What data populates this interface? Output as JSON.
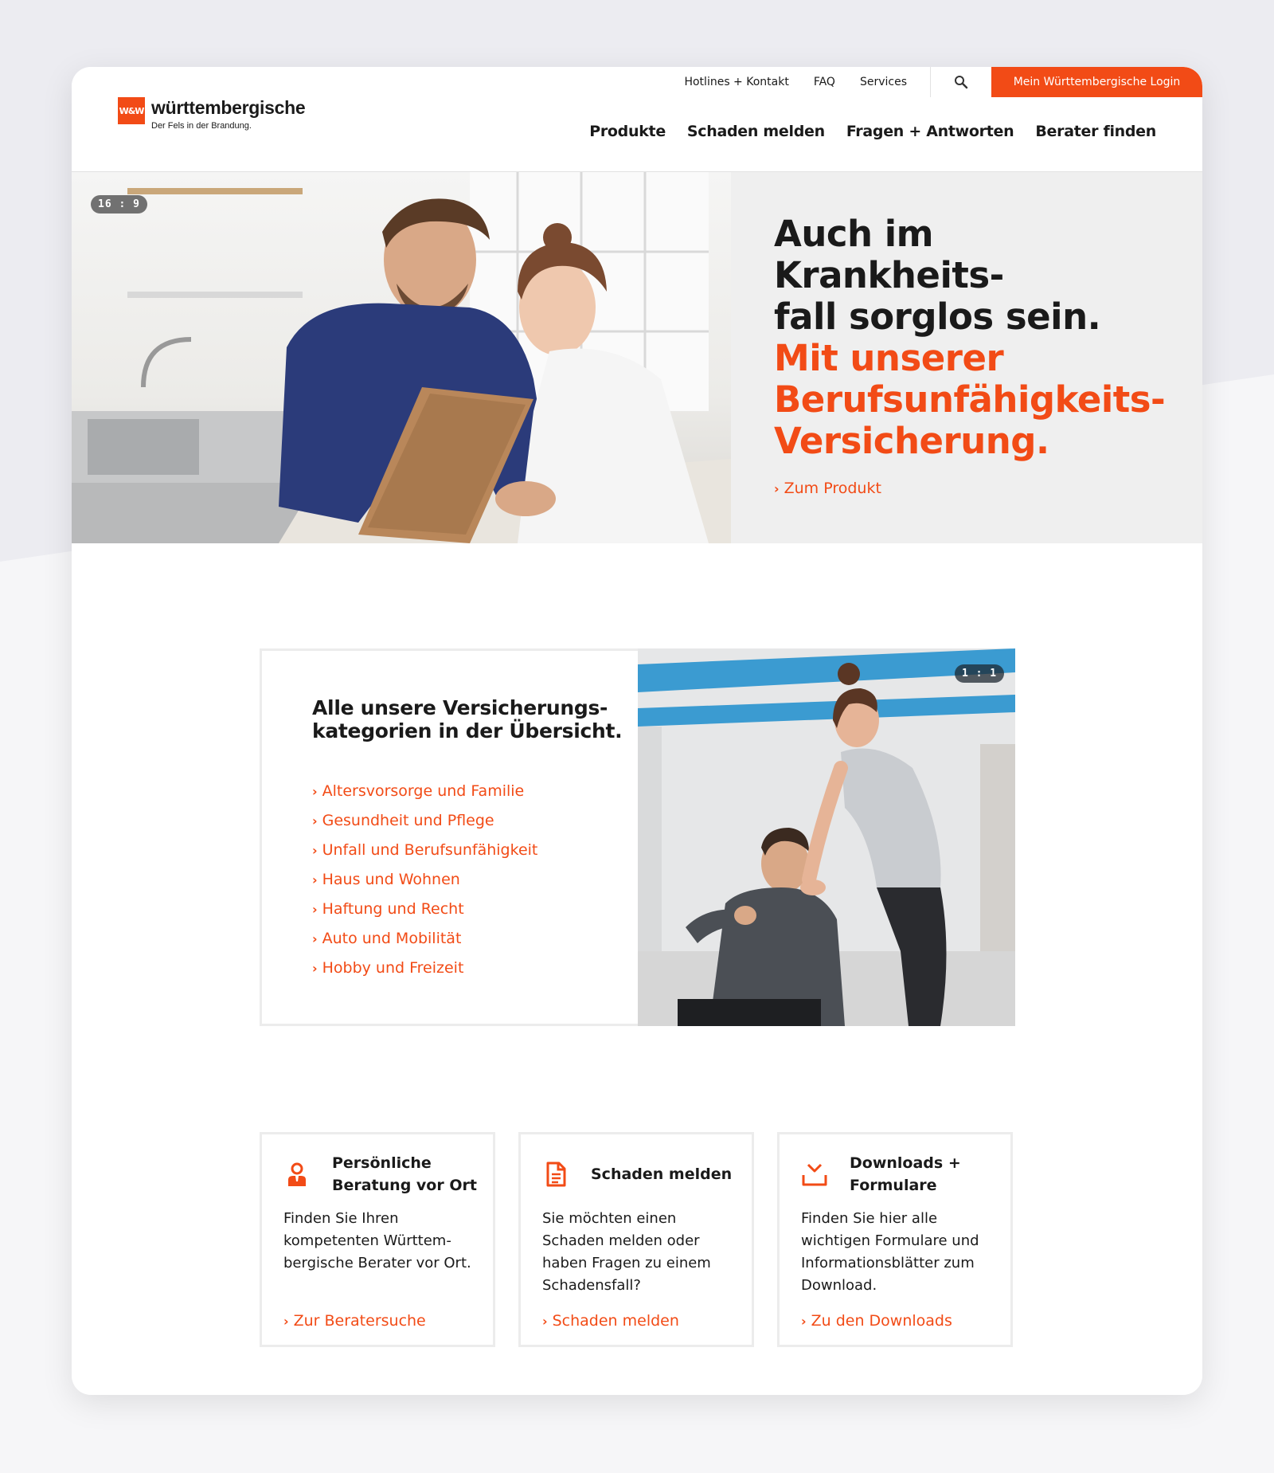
{
  "brand": {
    "name": "württembergische",
    "tagline": "Der Fels in der Brandung.",
    "mark": "W&W",
    "accent": "#f24b16"
  },
  "meta_nav": {
    "links": [
      "Hotlines + Kontakt",
      "FAQ",
      "Services"
    ],
    "login": "Mein Württembergische Login"
  },
  "main_nav": [
    "Produkte",
    "Schaden melden",
    "Fragen + Antworten",
    "Berater finden"
  ],
  "hero": {
    "ratio": "16 : 9",
    "headline": [
      "Auch im Krankheits-",
      "fall sorglos sein."
    ],
    "highlight": [
      "Mit unserer",
      "Berufsunfähigkeits-",
      "Versicherung."
    ],
    "cta": "Zum Produkt"
  },
  "categories": {
    "ratio": "1 : 1",
    "title": [
      "Alle unsere Versicherungs-",
      "kategorien in der Übersicht."
    ],
    "items": [
      "Altersvorsorge und Familie",
      "Gesundheit und Pflege",
      "Unfall und Berufsunfähigkeit",
      "Haus und Wohnen",
      "Haftung und Recht",
      "Auto und Mobilität",
      "Hobby und Freizeit"
    ]
  },
  "features": [
    {
      "icon": "advisor-icon",
      "title": [
        "Persönliche",
        "Beratung vor Ort"
      ],
      "body": [
        "Finden Sie Ihren",
        "kompetenten Württem-",
        "bergische Berater vor Ort."
      ],
      "link": "Zur Beratersuche"
    },
    {
      "icon": "document-icon",
      "title": [
        "Schaden melden"
      ],
      "body": [
        "Sie möchten einen",
        "Schaden melden oder",
        "haben Fragen zu einem",
        "Schadensfall?"
      ],
      "link": "Schaden melden"
    },
    {
      "icon": "download-icon",
      "title": [
        "Downloads +",
        "Formulare"
      ],
      "body": [
        "Finden Sie hier alle",
        "wichtigen Formulare und",
        "Informationsblätter zum",
        "Download."
      ],
      "link": "Zu den Downloads"
    }
  ]
}
